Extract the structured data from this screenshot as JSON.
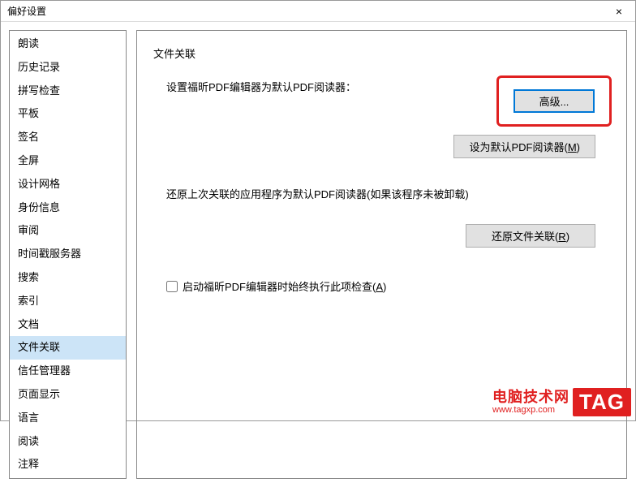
{
  "window": {
    "title": "偏好设置",
    "close": "×"
  },
  "sidebar": {
    "items": [
      {
        "label": "朗读"
      },
      {
        "label": "历史记录"
      },
      {
        "label": "拼写检查"
      },
      {
        "label": "平板"
      },
      {
        "label": "签名"
      },
      {
        "label": "全屏"
      },
      {
        "label": "设计网格"
      },
      {
        "label": "身份信息"
      },
      {
        "label": "审阅"
      },
      {
        "label": "时间戳服务器"
      },
      {
        "label": "搜索"
      },
      {
        "label": "索引"
      },
      {
        "label": "文档"
      },
      {
        "label": "文件关联",
        "selected": true
      },
      {
        "label": "信任管理器"
      },
      {
        "label": "页面显示"
      },
      {
        "label": "语言"
      },
      {
        "label": "阅读"
      },
      {
        "label": "注释"
      }
    ]
  },
  "main": {
    "group_label": "文件关联",
    "set_default_text": "设置福昕PDF编辑器为默认PDF阅读器：",
    "advanced_btn": "高级...",
    "set_default_btn_prefix": "设为默认PDF阅读器(",
    "set_default_btn_key": "M",
    "set_default_btn_suffix": ")",
    "restore_text": "还原上次关联的应用程序为默认PDF阅读器(如果该程序未被卸载)",
    "restore_btn_prefix": "还原文件关联(",
    "restore_btn_key": "R",
    "restore_btn_suffix": ")",
    "checkbox_prefix": "启动福昕PDF编辑器时始终执行此项检查(",
    "checkbox_key": "A",
    "checkbox_suffix": ")"
  },
  "watermark": {
    "text_top": "电脑技术网",
    "text_bottom": "www.tagxp.com",
    "tag": "TAG"
  }
}
